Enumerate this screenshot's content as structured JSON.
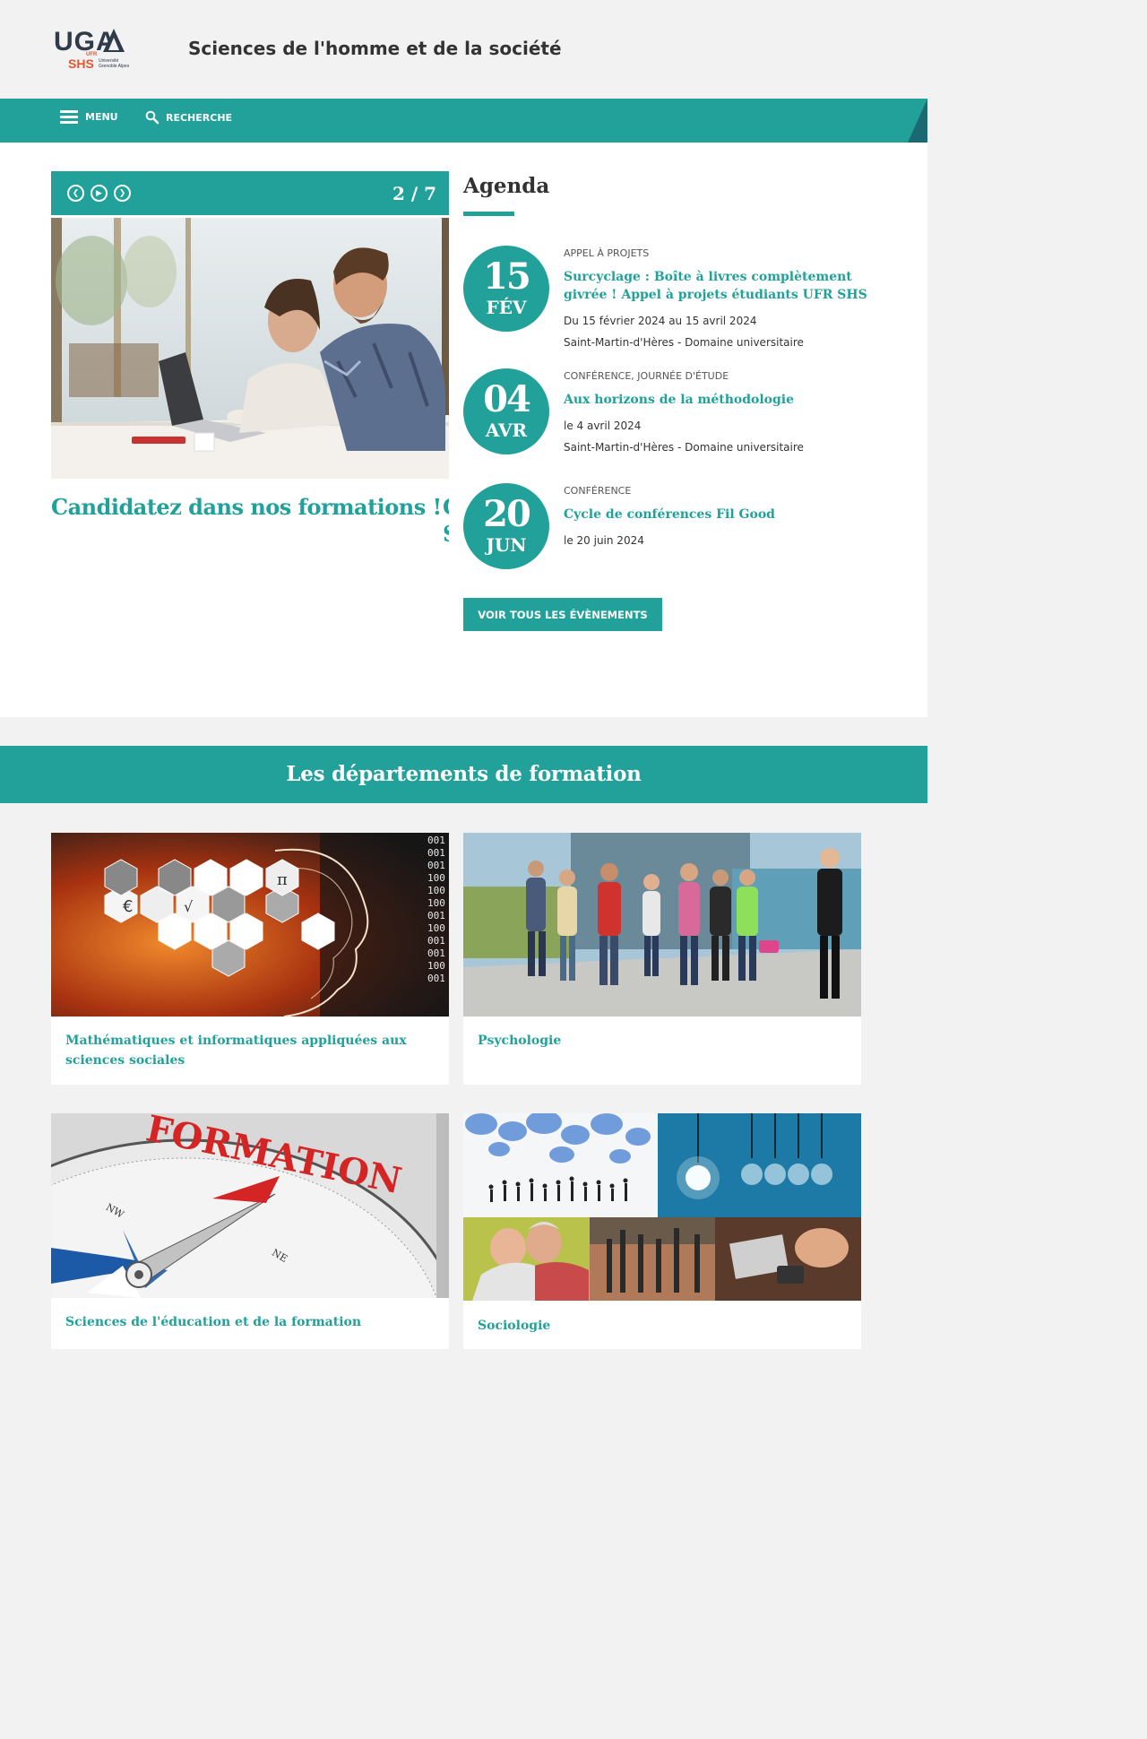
{
  "header": {
    "logo": {
      "uga": "UGA",
      "ufr": "UFR",
      "shs": "SHS",
      "university": "Université Grenoble Alpes"
    },
    "site_title": "Sciences de l'homme et de la société"
  },
  "nav": {
    "menu_label": "MENU",
    "search_label": "RECHERCHE"
  },
  "slider": {
    "counter": "2 / 7",
    "title": "Candidatez dans nos formations !",
    "next_peek": "C S"
  },
  "agenda": {
    "title": "Agenda",
    "events": [
      {
        "day": "15",
        "month": "FÉV",
        "category": "APPEL À PROJETS",
        "title": "Surcyclage : Boîte à livres complètement givrée ! Appel à projets étudiants UFR SHS",
        "dates": "Du 15 février 2024 au 15 avril 2024",
        "location": "Saint-Martin-d'Hères - Domaine universitaire"
      },
      {
        "day": "04",
        "month": "AVR",
        "category": "CONFÉRENCE, JOURNÉE D'ÉTUDE",
        "title": "Aux horizons de la méthodologie",
        "dates": "le 4 avril 2024",
        "location": "Saint-Martin-d'Hères - Domaine universitaire"
      },
      {
        "day": "20",
        "month": "JUN",
        "category": "CONFÉRENCE",
        "title": "Cycle de conférences Fil Good",
        "dates": "le 20 juin 2024"
      }
    ],
    "all_events_label": "VOIR TOUS LES ÉVÈNEMENTS"
  },
  "departments": {
    "title": "Les départements de formation",
    "items": [
      {
        "label": "Mathématiques et informatiques appliquées aux sciences sociales"
      },
      {
        "label": "Psychologie"
      },
      {
        "label": "Sciences de l'éducation et de la formation",
        "image_text": "FORMATION"
      },
      {
        "label": "Sociologie"
      }
    ]
  },
  "colors": {
    "accent": "#21a19a",
    "accent_dark": "#1b6a73",
    "logo_orange": "#e4572e",
    "logo_navy": "#2f3a4a"
  }
}
